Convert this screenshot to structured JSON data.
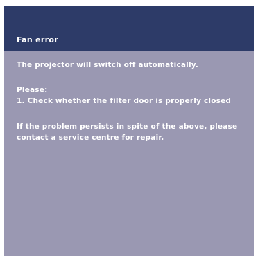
{
  "dialog": {
    "title": "Fan error",
    "lines": [
      "The projector will switch off automatically.",
      "Please:",
      "1. Check whether the filter door is properly closed",
      "If the problem persists in spite of the above, please",
      "contact a service centre for repair."
    ],
    "colors": {
      "title_bar": "#2d3b68",
      "body": "#9a98b2",
      "text": "#ffffff"
    }
  }
}
